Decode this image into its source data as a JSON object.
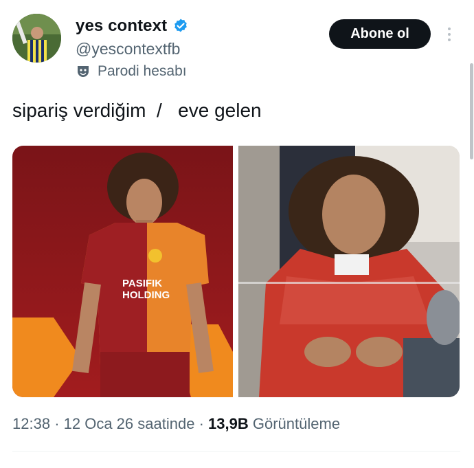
{
  "header": {
    "display_name": "yes context",
    "handle": "@yescontextfb",
    "parody_label": "Parodi hesabı",
    "follow_label": "Abone ol"
  },
  "tweet": {
    "text": "sipariş verdiğim  /   eve gelen"
  },
  "media": {
    "left_image_caption": "PASIFIK HOLDING",
    "left_image_caption_line1": "PASIFIK",
    "left_image_caption_line2": "HOLDING"
  },
  "meta": {
    "time": "12:38",
    "date": "12 Oca 26 saatinde",
    "separator": "·",
    "views_count": "13,9B",
    "views_label": "Görüntüleme"
  },
  "colors": {
    "accent": "#1d9bf0",
    "text_primary": "#0f1419",
    "text_secondary": "#536471",
    "follow_bg": "#0f1419"
  },
  "icons": {
    "verified": "verified-badge-icon",
    "parody": "theater-mask-icon",
    "more": "more-vertical-icon"
  }
}
